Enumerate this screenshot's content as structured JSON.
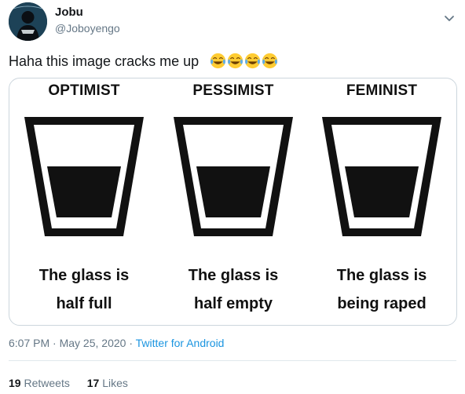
{
  "author": {
    "name": "Jobu",
    "handle": "@Joboyengo"
  },
  "tweet": {
    "text": "Haha this image cracks me up",
    "emojis": [
      "joy-emoji",
      "joy-emoji",
      "joy-emoji",
      "joy-emoji"
    ]
  },
  "media": {
    "panels": [
      {
        "title": "OPTIMIST",
        "caption_line1": "The glass is",
        "caption_line2": "half full"
      },
      {
        "title": "PESSIMIST",
        "caption_line1": "The glass is",
        "caption_line2": "half empty"
      },
      {
        "title": "FEMINIST",
        "caption_line1": "The glass is",
        "caption_line2": "being raped"
      }
    ]
  },
  "meta": {
    "time": "6:07 PM",
    "separator": "·",
    "date": "May 25, 2020",
    "app": "Twitter for Android"
  },
  "stats": {
    "retweets_count": "19",
    "retweets_label": "Retweets",
    "likes_count": "17",
    "likes_label": "Likes"
  },
  "colors": {
    "link": "#1b95e0",
    "secondary_text": "#657786",
    "border": "#ccd6dd"
  }
}
